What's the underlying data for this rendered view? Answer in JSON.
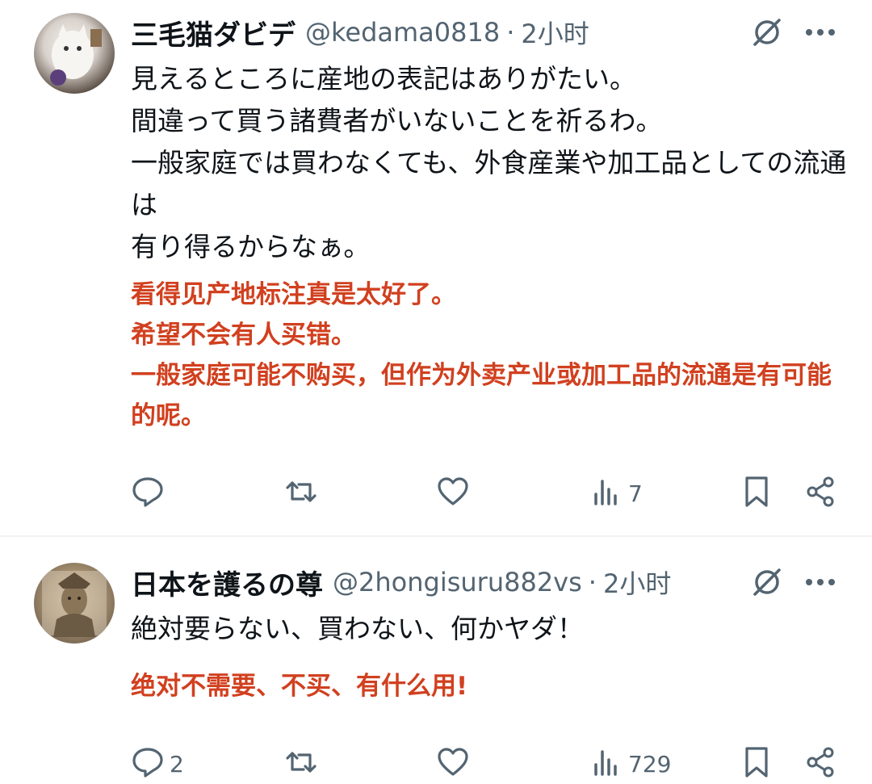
{
  "tweets": [
    {
      "author_name": "三毛猫ダビデ",
      "handle": "@kedama0818",
      "separator": "·",
      "time": "2小时",
      "text": "見えるところに産地の表記はありがたい。\n間違って買う諸費者がいないことを祈るわ。\n一般家庭では買わなくても、外食産業や加工品としての流通は\n有り得るからなぁ。",
      "translation": "看得见产地标注真是太好了。\n希望不会有人买错。\n一般家庭可能不购买，但作为外卖产业或加工品的流通是有可能的呢。",
      "replies": "",
      "views": "7"
    },
    {
      "author_name": "日本を護るの尊",
      "handle": "@2hongisuru882vs",
      "separator": "·",
      "time": "2小时",
      "text": "絶対要らない、買わない、何かヤダ！",
      "translation": "绝对不需要、不买、有什么用!",
      "replies": "2",
      "views": "729"
    }
  ],
  "colors": {
    "text": "#0f1419",
    "secondary": "#536471",
    "translation": "#d1401f",
    "divider": "#eff3f4"
  },
  "icons": [
    "grok-icon",
    "more-icon",
    "reply-icon",
    "retweet-icon",
    "like-icon",
    "views-icon",
    "bookmark-icon",
    "share-icon"
  ]
}
